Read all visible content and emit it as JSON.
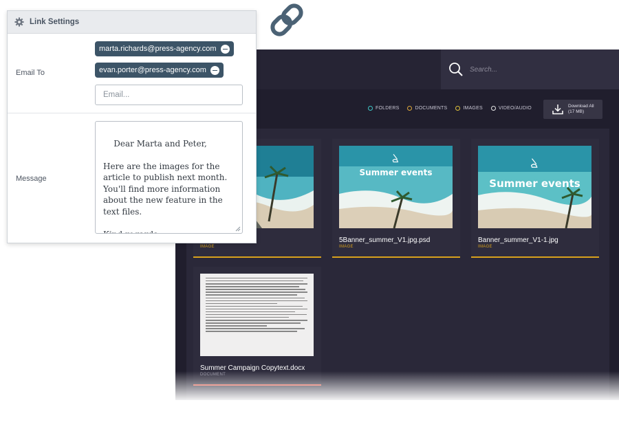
{
  "panel": {
    "title": "Link Settings",
    "email_to_label": "Email To",
    "recipients": [
      "marta.richards@press-agency.com",
      "evan.porter@press-agency.com"
    ],
    "email_placeholder": "Email...",
    "message_label": "Message",
    "message": "Dear Marta and Peter,\n\nHere are the images for the article to publish next month. You'll find more information about the new feature in the text files.\n\nKind regards,"
  },
  "browser": {
    "search_placeholder": "Search...",
    "filters": [
      {
        "label": "FOLDERS",
        "color": "#3ec7c7"
      },
      {
        "label": "DOCUMENTS",
        "color": "#e0a93a"
      },
      {
        "label": "IMAGES",
        "color": "#e0c23a"
      },
      {
        "label": "VIDEO/AUDIO",
        "color": "#e8e8e8"
      }
    ],
    "download": {
      "label": "Download All",
      "size": "(17 MB)"
    },
    "files": [
      {
        "name": "",
        "type": "IMAGE",
        "accent": "#d9a21c"
      },
      {
        "name": "5Banner_summer_V1.jpg.psd",
        "type": "IMAGE",
        "overlay": "Summer events",
        "accent": "#d9a21c"
      },
      {
        "name": "Banner_summer_V1-1.jpg",
        "type": "IMAGE",
        "overlay": "Summer events",
        "accent": "#d9a21c"
      },
      {
        "name": "Summer Campaign Copytext.docx",
        "type": "DOCUMENT",
        "accent": "#e05a4a"
      }
    ]
  }
}
